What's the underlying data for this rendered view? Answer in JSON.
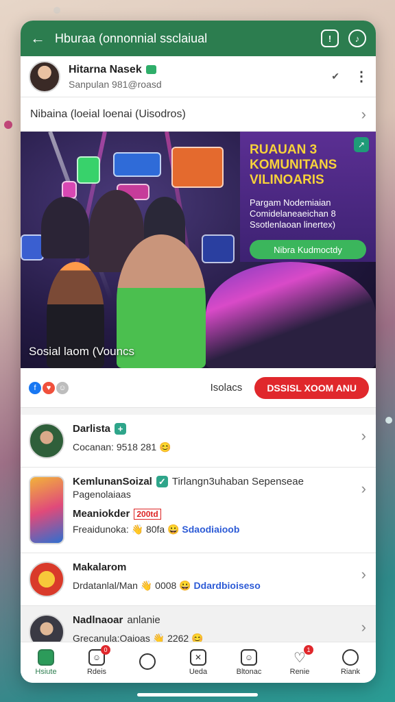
{
  "topbar": {
    "title": "Hburaa (onnonnial ssclaiual",
    "left_icon": "back-arrow-icon",
    "icon1": "info-icon",
    "icon2": "music-icon"
  },
  "profile": {
    "name": "Hitarna Nasek",
    "subtitle": "Sanpulan 981@roasd"
  },
  "section": {
    "label": "Nibaina (loeial loenai (Uisodros)"
  },
  "banner": {
    "promo_title": "RUAUAN 3 KOMUNITANS VILINOARIS",
    "promo_desc": "Pargam Nodemiaian Comidelaneaeichan 8 Ssotlenlaoan linertex)",
    "promo_button": "Nibra Kudmoctdy",
    "caption": "Sosial laom (Vouncs"
  },
  "reactions": {
    "likes": "Isolacs",
    "join_button": "DSSISL XOOM ANU"
  },
  "list": [
    {
      "title": "Darlista",
      "meta": "Cocanan: 9518 281"
    },
    {
      "title": "KemlunanSoizal",
      "title2": "Tirlangn3uhaban Sepenseae",
      "subtitle": "Pagenolaiaas",
      "line2": "Meaniokder",
      "badge": "200td",
      "meta_a": "Freaidunoka:",
      "meta_b": "80fa",
      "meta_c": "Sdaodiaioob"
    },
    {
      "title": "Makalarom",
      "meta_a": "Drdatanlal/Man",
      "meta_b": "0008",
      "meta_c": "Ddardbioiseso"
    },
    {
      "title": "Nadlnaoar",
      "title2": "anlanie",
      "meta": "Grecanula:Oaioas",
      "meta_b": "2262"
    }
  ],
  "nav": [
    {
      "label": "Hsiute",
      "badge": ""
    },
    {
      "label": "Rdeis",
      "badge": "0"
    },
    {
      "label": "",
      "badge": ""
    },
    {
      "label": "Ueda",
      "badge": ""
    },
    {
      "label": "Bltonac",
      "badge": ""
    },
    {
      "label": "Renie",
      "badge": "1"
    },
    {
      "label": "Riank",
      "badge": ""
    }
  ],
  "colors": {
    "primary": "#2c7d4f",
    "accent_red": "#e0282c",
    "promo_bg": "#5b2f93",
    "promo_title": "#f7d23a"
  }
}
